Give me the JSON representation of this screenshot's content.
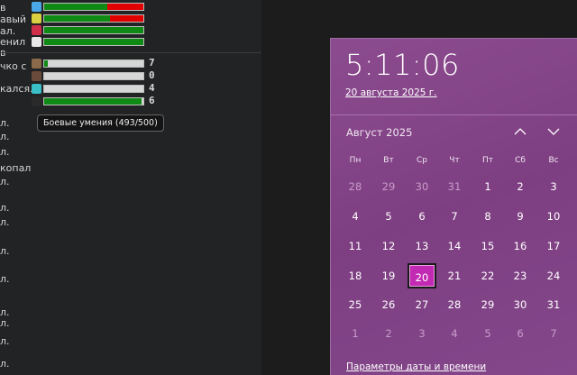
{
  "left_fragments": [
    "в",
    "авый",
    "ал.",
    "енил",
    "в",
    "чко с",
    "кался.",
    "л.",
    "л.",
    "л.",
    "копал",
    "л.",
    "л.",
    "л.",
    "л.",
    "л.",
    "л.",
    "л.",
    "л.",
    "л."
  ],
  "skills": [
    {
      "icon": "droplet-icon",
      "fill_fraction": 0.64,
      "secondary": "red"
    },
    {
      "icon": "lightbulb-icon",
      "fill_fraction": 0.66,
      "secondary": "red"
    },
    {
      "icon": "heart-icon",
      "fill_fraction": 1.0,
      "secondary": "none"
    },
    {
      "icon": "paper-icon",
      "fill_fraction": 1.0,
      "secondary": "none"
    },
    {
      "icon": "pickaxe-icon",
      "fill_fraction": 0.04,
      "value": "7"
    },
    {
      "icon": "boot-icon",
      "fill_fraction": 0.0,
      "value": "0"
    },
    {
      "icon": "gem-icon",
      "fill_fraction": 0.0,
      "value": "4"
    },
    {
      "icon": "paw-icon",
      "fill_fraction": 0.986,
      "value": "6"
    }
  ],
  "tooltip": "Боевые умения (493/500)",
  "colors": {
    "bar_green": "#0f8a14",
    "bar_red": "#e00000",
    "bar_grey": "#d6d6d6",
    "flyout_bg": "#8c4b8f",
    "today_bg": "#c22ab3"
  },
  "calendar": {
    "time": "5:11:06",
    "date_long": "20 августа 2025 г.",
    "month": "Август 2025",
    "weekdays": [
      "Пн",
      "Вт",
      "Ср",
      "Чт",
      "Пт",
      "Сб",
      "Вс"
    ],
    "weeks": [
      [
        "28",
        "29",
        "30",
        "31",
        "1",
        "2",
        "3"
      ],
      [
        "4",
        "5",
        "6",
        "7",
        "8",
        "9",
        "10"
      ],
      [
        "11",
        "12",
        "13",
        "14",
        "15",
        "16",
        "17"
      ],
      [
        "18",
        "19",
        "20",
        "21",
        "22",
        "23",
        "24"
      ],
      [
        "25",
        "26",
        "27",
        "28",
        "29",
        "30",
        "31"
      ],
      [
        "1",
        "2",
        "3",
        "4",
        "5",
        "6",
        "7"
      ]
    ],
    "dim_rows": [
      0,
      5
    ],
    "dim_first_row_count": 4,
    "today": "20",
    "settings_link": "Параметры даты и времени",
    "nav_icons": [
      "chevron-up-icon",
      "chevron-down-icon"
    ]
  }
}
